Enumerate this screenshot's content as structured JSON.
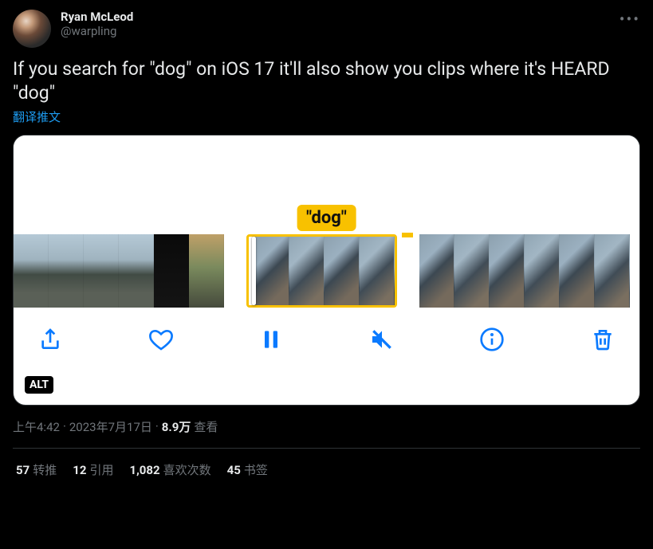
{
  "author": {
    "name": "Ryan McLeod",
    "handle": "@warpling"
  },
  "text": "If you search for \"dog\" on iOS 17 it'll also show you clips where it's HEARD \"dog\"",
  "translate_label": "翻译推文",
  "media": {
    "badge_text": "\"dog\"",
    "alt_label": "ALT"
  },
  "meta": {
    "time": "上午4:42",
    "sep": " · ",
    "date": "2023年7月17日",
    "views_num": "8.9万",
    "views_label": " 查看"
  },
  "stats": {
    "retweets_num": "57",
    "retweets_label": "转推",
    "quotes_num": "12",
    "quotes_label": "引用",
    "likes_num": "1,082",
    "likes_label": "喜欢次数",
    "bookmarks_num": "45",
    "bookmarks_label": "书签"
  }
}
